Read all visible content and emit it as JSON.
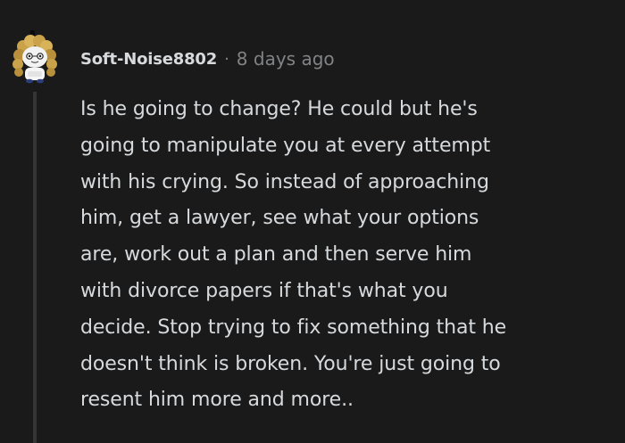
{
  "comment": {
    "username": "Soft-Noise8802",
    "separator": "·",
    "timestamp": "8 days ago",
    "avatar_icon": "snoo-avatar-icon",
    "body_lines": [
      "Is he going to change? He could but he's",
      "going to manipulate you at every attempt",
      "with his crying. So instead of approaching",
      "him, get a lawyer, see what your options",
      "are, work out a plan and then serve him",
      "with divorce papers if that's what you",
      "decide. Stop trying to fix something that he",
      "doesn't think is broken. You're just going to",
      "resent him more and more.."
    ]
  },
  "colors": {
    "background": "#1a1a1b",
    "text": "#d7dadc",
    "muted": "#818384",
    "thread_line": "#343536"
  }
}
